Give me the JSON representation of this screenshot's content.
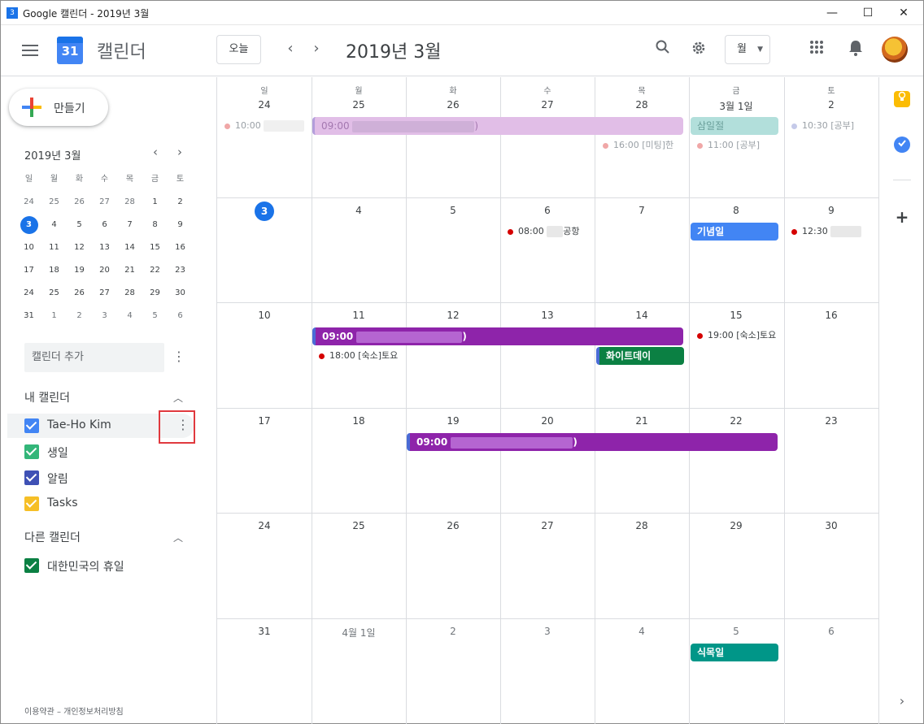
{
  "window": {
    "title": "Google 캘린더 - 2019년 3월",
    "icon_text": "3",
    "controls": [
      "—",
      "☐",
      "✕"
    ]
  },
  "header": {
    "app_name": "캘린더",
    "logo_day": "31",
    "today_label": "오늘",
    "prev_icon": "‹",
    "next_icon": "›",
    "current_period": "2019년 3월",
    "view_label": "월",
    "icons": [
      "search-icon",
      "gear-icon",
      "apps-icon",
      "bell-icon"
    ]
  },
  "sidebar": {
    "create_label": "만들기",
    "mini_title": "2019년 3월",
    "mini_weekdays": [
      "일",
      "월",
      "화",
      "수",
      "목",
      "금",
      "토"
    ],
    "mini_weeks": [
      [
        "24",
        "25",
        "26",
        "27",
        "28",
        "1",
        "2"
      ],
      [
        "3",
        "4",
        "5",
        "6",
        "7",
        "8",
        "9"
      ],
      [
        "10",
        "11",
        "12",
        "13",
        "14",
        "15",
        "16"
      ],
      [
        "17",
        "18",
        "19",
        "20",
        "21",
        "22",
        "23"
      ],
      [
        "24",
        "25",
        "26",
        "27",
        "28",
        "29",
        "30"
      ],
      [
        "31",
        "1",
        "2",
        "3",
        "4",
        "5",
        "6"
      ]
    ],
    "add_calendar_placeholder": "캘린더 추가",
    "my_calendars_title": "내 캘린더",
    "my_calendars": [
      {
        "name": "Tae-Ho Kim",
        "color": "#4285f4"
      },
      {
        "name": "생일",
        "color": "#33b679"
      },
      {
        "name": "알림",
        "color": "#3f51b5"
      },
      {
        "name": "Tasks",
        "color": "#f6bf26"
      }
    ],
    "other_calendars_title": "다른 캘린더",
    "other_calendars": [
      {
        "name": "대한민국의 휴일",
        "color": "#0b8043"
      }
    ],
    "footer": "이용약관 – 개인정보처리방침"
  },
  "grid": {
    "weekdays": [
      "일",
      "월",
      "화",
      "수",
      "목",
      "금",
      "토"
    ],
    "weeks": [
      [
        "24",
        "25",
        "26",
        "27",
        "28",
        "3월 1일",
        "2"
      ],
      [
        "3",
        "4",
        "5",
        "6",
        "7",
        "8",
        "9"
      ],
      [
        "10",
        "11",
        "12",
        "13",
        "14",
        "15",
        "16"
      ],
      [
        "17",
        "18",
        "19",
        "20",
        "21",
        "22",
        "23"
      ],
      [
        "24",
        "25",
        "26",
        "27",
        "28",
        "29",
        "30"
      ],
      [
        "31",
        "4월 1일",
        "2",
        "3",
        "4",
        "5",
        "6"
      ]
    ],
    "events": {
      "w0_sun": "10:00",
      "w0_span": "09:00",
      "w0_span_tail": ")",
      "w0_holiday": "삼일절",
      "w0_sat": "10:30 [공부]",
      "w0_thu": "16:00 [미팅]한",
      "w0_fri": "11:00 [공부]",
      "w1_wed": "08:00",
      "w1_wed_tail": "공항",
      "w1_holiday": "기념일",
      "w1_sat": "12:30",
      "w2_span": "09:00",
      "w2_span_tail": ")",
      "w2_mon": "18:00 [숙소]토요",
      "w2_white": "화이트데이",
      "w2_fri": "19:00 [숙소]토요",
      "w3_span": "09:00",
      "w3_span_tail": ")",
      "w5_holiday": "식목일"
    },
    "colors": {
      "purple": "#8e24aa",
      "light_purple": "#e1bee7",
      "blue": "#4285f4",
      "green": "#0b8043",
      "teal": "#009688",
      "red_dot": "#d50000"
    }
  }
}
